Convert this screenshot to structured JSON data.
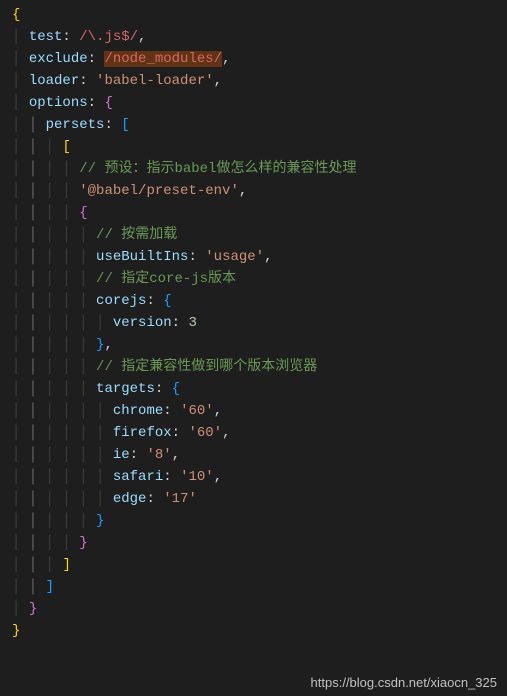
{
  "lines": {
    "l1_brace": "{",
    "l2_prop": "test",
    "l2_colon": ":",
    "l2_regex": "/\\.js$/",
    "l2_comma": ",",
    "l3_prop": "exclude",
    "l3_colon": ":",
    "l3_regex": "/node_modules/",
    "l3_comma": ",",
    "l4_prop": "loader",
    "l4_colon": ":",
    "l4_str": "'babel-loader'",
    "l4_comma": ",",
    "l5_prop": "options",
    "l5_colon": ":",
    "l5_brace": "{",
    "l6_prop": "persets",
    "l6_colon": ":",
    "l6_bracket": "[",
    "l7_bracket": "[",
    "l8_comment": "// 预设：指示babel做怎么样的兼容性处理",
    "l9_str": "'@babel/preset-env'",
    "l9_comma": ",",
    "l10_brace": "{",
    "l11_comment": "// 按需加载",
    "l12_prop": "useBuiltIns",
    "l12_colon": ":",
    "l12_str": "'usage'",
    "l12_comma": ",",
    "l13_comment": "// 指定core-js版本",
    "l14_prop": "corejs",
    "l14_colon": ":",
    "l14_brace": "{",
    "l15_prop": "version",
    "l15_colon": ":",
    "l15_num": "3",
    "l16_brace": "}",
    "l16_comma": ",",
    "l17_comment": "// 指定兼容性做到哪个版本浏览器",
    "l18_prop": "targets",
    "l18_colon": ":",
    "l18_brace": "{",
    "l19_prop": "chrome",
    "l19_colon": ":",
    "l19_str": "'60'",
    "l19_comma": ",",
    "l20_prop": "firefox",
    "l20_colon": ":",
    "l20_str": "'60'",
    "l20_comma": ",",
    "l21_prop": "ie",
    "l21_colon": ":",
    "l21_str": "'8'",
    "l21_comma": ",",
    "l22_prop": "safari",
    "l22_colon": ":",
    "l22_str": "'10'",
    "l22_comma": ",",
    "l23_prop": "edge",
    "l23_colon": ":",
    "l23_str": "'17'",
    "l24_brace": "}",
    "l25_brace": "}",
    "l26_bracket": "]",
    "l27_bracket": "]",
    "l28_brace": "}",
    "l29_brace": "}"
  },
  "watermark": "https://blog.csdn.net/xiaocn_325",
  "colors": {
    "background": "#1e1e1e",
    "property": "#9cdcfe",
    "string": "#ce9178",
    "regex": "#d16969",
    "comment": "#6a9955",
    "number": "#b5cea8",
    "brace_yellow": "#ffd700",
    "brace_purple": "#da70d6",
    "brace_blue": "#179fff"
  }
}
